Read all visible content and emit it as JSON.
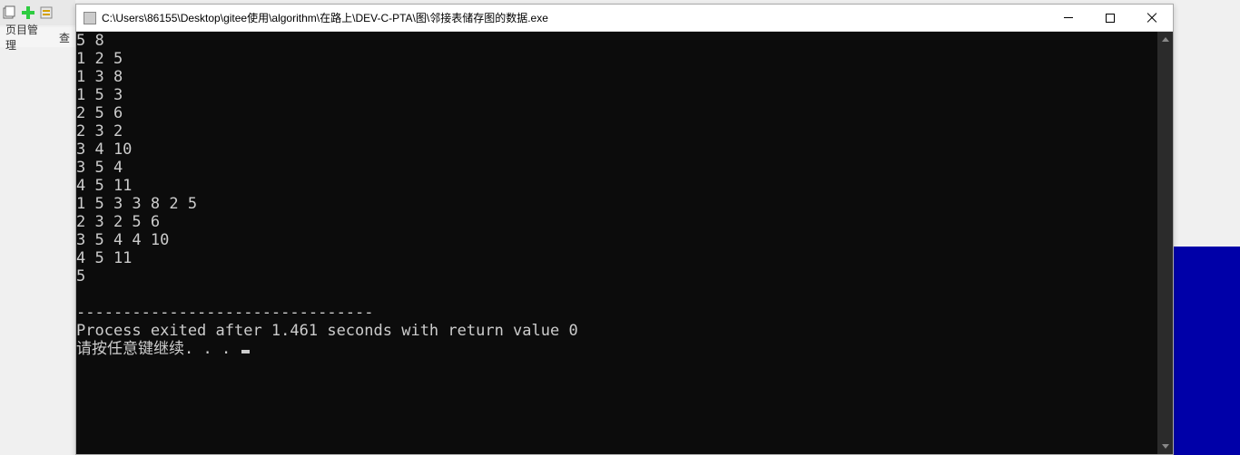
{
  "ide": {
    "menu_left": "页目管理",
    "menu_right": "查"
  },
  "window": {
    "title": "C:\\Users\\86155\\Desktop\\gitee使用\\algorithm\\在路上\\DEV-C-PTA\\图\\邻接表储存图的数据.exe"
  },
  "console": {
    "lines": [
      "5 8",
      "1 2 5",
      "1 3 8",
      "1 5 3",
      "2 5 6",
      "2 3 2",
      "3 4 10",
      "3 5 4",
      "4 5 11",
      "1 5 3 3 8 2 5",
      "2 3 2 5 6",
      "3 5 4 4 10",
      "4 5 11",
      "5",
      "",
      "--------------------------------",
      "Process exited after 1.461 seconds with return value 0"
    ],
    "prompt": "请按任意键继续. . . "
  }
}
